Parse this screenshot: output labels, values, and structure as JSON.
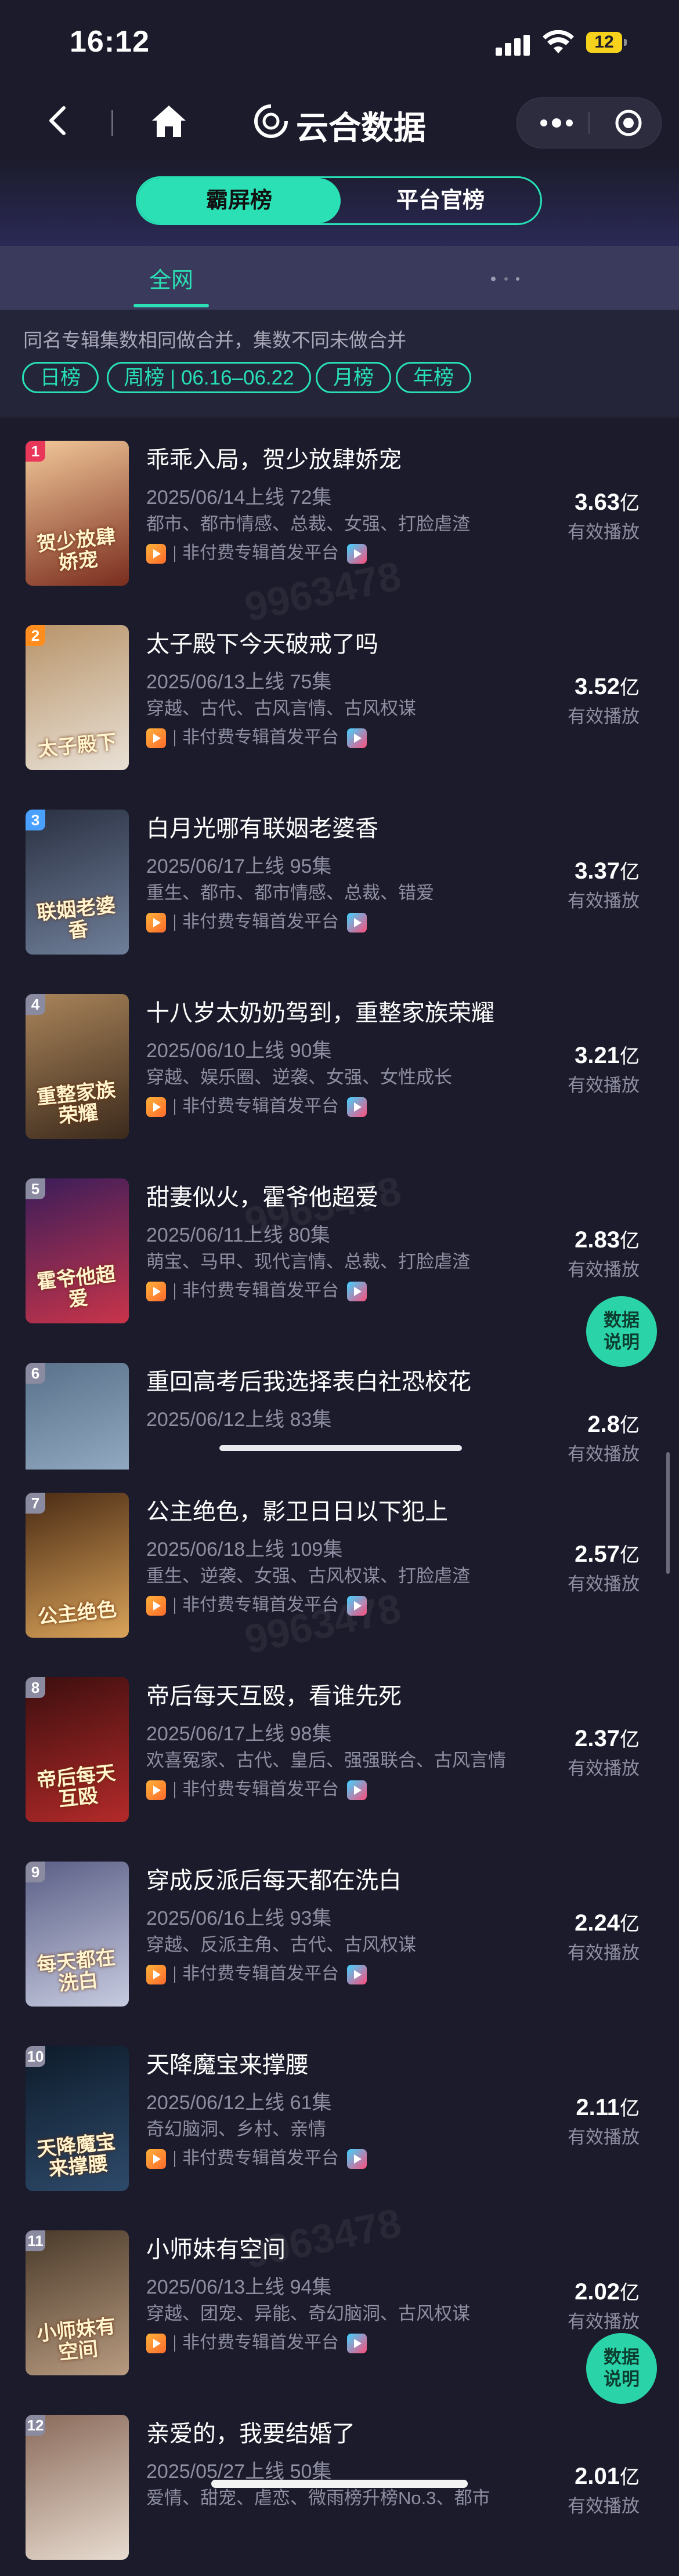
{
  "status": {
    "time": "16:12",
    "battery": "12"
  },
  "nav": {
    "title": "云合数据"
  },
  "segment": {
    "left": "霸屏榜",
    "right": "平台官榜"
  },
  "tabs": {
    "active": "全网"
  },
  "filter": {
    "note": "同名专辑集数相同做合并，集数不同未做合并",
    "chips": [
      "日榜",
      "周榜 | 06.16–06.22",
      "月榜",
      "年榜"
    ]
  },
  "items": [
    {
      "rank": "1",
      "title": "乖乖入局，贺少放肆娇宠",
      "date_eps": "2025/06/14上线 72集",
      "tags": "都市、都市情感、总裁、女强、打脸虐渣",
      "platform": "非付费专辑首发平台",
      "value": "3.63",
      "unit": "亿",
      "vlabel": "有效播放",
      "cover_text": "贺少放肆娇宠",
      "color1": "#7a2d1e",
      "color2": "#f2c89a",
      "rank_color": "#e9375a"
    },
    {
      "rank": "2",
      "title": "太子殿下今天破戒了吗",
      "date_eps": "2025/06/13上线 75集",
      "tags": "穿越、古代、古风言情、古风权谋",
      "platform": "非付费专辑首发平台",
      "value": "3.52",
      "unit": "亿",
      "vlabel": "有效播放",
      "cover_text": "太子殿下",
      "color1": "#e9e1d6",
      "color2": "#b8946a",
      "rank_color": "#ff8e1f"
    },
    {
      "rank": "3",
      "title": "白月光哪有联姻老婆香",
      "date_eps": "2025/06/17上线 95集",
      "tags": "重生、都市、都市情感、总裁、错爱",
      "platform": "非付费专辑首发平台",
      "value": "3.37",
      "unit": "亿",
      "vlabel": "有效播放",
      "cover_text": "联姻老婆香",
      "color1": "#6f7f99",
      "color2": "#2a3042",
      "rank_color": "#4aa0ff"
    },
    {
      "rank": "4",
      "title": "十八岁太奶奶驾到，重整家族荣耀",
      "date_eps": "2025/06/10上线 90集",
      "tags": "穿越、娱乐圈、逆袭、女强、女性成长",
      "platform": "非付费专辑首发平台",
      "value": "3.21",
      "unit": "亿",
      "vlabel": "有效播放",
      "cover_text": "重整家族荣耀",
      "color1": "#3c2a1c",
      "color2": "#a9845a",
      "rank_color": "#8a8aa0"
    },
    {
      "rank": "5",
      "title": "甜妻似火，霍爷他超爱",
      "date_eps": "2025/06/11上线 80集",
      "tags": "萌宝、马甲、现代言情、总裁、打脸虐渣",
      "platform": "非付费专辑首发平台",
      "value": "2.83",
      "unit": "亿",
      "vlabel": "有效播放",
      "cover_text": "霍爷他超爱",
      "color1": "#c9344a",
      "color2": "#3a1d5a",
      "rank_color": "#8a8aa0"
    },
    {
      "rank": "6",
      "title": "重回高考后我选择表白社恐校花",
      "date_eps": "2025/06/12上线 83集",
      "tags": "",
      "platform": "",
      "value": "2.8",
      "unit": "亿",
      "vlabel": "有效播放",
      "cover_text": "",
      "color1": "#a0b7cf",
      "color2": "#59718a",
      "rank_color": "#8a8aa0"
    },
    {
      "rank": "7",
      "title": "公主绝色，影卫日日以下犯上",
      "date_eps": "2025/06/18上线 109集",
      "tags": "重生、逆袭、女强、古风权谋、打脸虐渣",
      "platform": "非付费专辑首发平台",
      "value": "2.57",
      "unit": "亿",
      "vlabel": "有效播放",
      "cover_text": "公主绝色",
      "color1": "#d9a35a",
      "color2": "#4a2b14",
      "rank_color": "#8a8aa0"
    },
    {
      "rank": "8",
      "title": "帝后每天互殴，看谁先死",
      "date_eps": "2025/06/17上线 98集",
      "tags": "欢喜冤家、古代、皇后、强强联合、古风言情",
      "platform": "非付费专辑首发平台",
      "value": "2.37",
      "unit": "亿",
      "vlabel": "有效播放",
      "cover_text": "帝后每天互殴",
      "color1": "#b42a2a",
      "color2": "#3c0e0e",
      "rank_color": "#8a8aa0"
    },
    {
      "rank": "9",
      "title": "穿成反派后每天都在洗白",
      "date_eps": "2025/06/16上线 93集",
      "tags": "穿越、反派主角、古代、古风权谋",
      "platform": "非付费专辑首发平台",
      "value": "2.24",
      "unit": "亿",
      "vlabel": "有效播放",
      "cover_text": "每天都在洗白",
      "color1": "#c7cbe0",
      "color2": "#5b5f86",
      "rank_color": "#8a8aa0"
    },
    {
      "rank": "10",
      "title": "天降魔宝来撑腰",
      "date_eps": "2025/06/12上线 61集",
      "tags": "奇幻脑洞、乡村、亲情",
      "platform": "非付费专辑首发平台",
      "value": "2.11",
      "unit": "亿",
      "vlabel": "有效播放",
      "cover_text": "天降魔宝来撑腰",
      "color1": "#2e4a6a",
      "color2": "#0d1b2a",
      "rank_color": "#8a8aa0"
    },
    {
      "rank": "11",
      "title": "小师妹有空间",
      "date_eps": "2025/06/13上线 94集",
      "tags": "穿越、团宠、异能、奇幻脑洞、古风权谋",
      "platform": "非付费专辑首发平台",
      "value": "2.02",
      "unit": "亿",
      "vlabel": "有效播放",
      "cover_text": "小师妹有空间",
      "color1": "#b89b80",
      "color2": "#4a3a2a",
      "rank_color": "#8a8aa0"
    },
    {
      "rank": "12",
      "title": "亲爱的，我要结婚了",
      "date_eps": "2025/05/27上线 50集",
      "tags": "爱情、甜宠、虐恋、微雨榜升榜No.3、都市",
      "platform": "",
      "value": "2.01",
      "unit": "亿",
      "vlabel": "有效播放",
      "cover_text": "",
      "color1": "#e8dcd0",
      "color2": "#8a6a5a",
      "rank_color": "#8a8aa0"
    }
  ],
  "float_button": {
    "label": "数据说明"
  },
  "watermark_text": "9963478"
}
